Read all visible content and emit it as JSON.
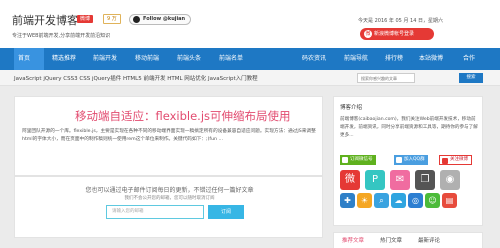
{
  "header": {
    "site_title": "前端开发博客",
    "hot_tag": "微博",
    "count_tag": "9 万",
    "follow_label": "Follow @kujian",
    "slogan": "专注于WEB前端开发,分享前端开发前沿知识",
    "date": "今天是 2016 年 05 月 14 日，星期六",
    "weibo_login": "新浪微博帐号登录"
  },
  "nav": {
    "items": [
      "首页",
      "精选推荐",
      "前端开发",
      "移动前端",
      "前端头条",
      "前端名单",
      "码农资讯",
      "前端导航",
      "排行榜",
      "本站微博",
      "合作"
    ]
  },
  "subnav": {
    "tags": "JavaScript  jQuery  CSS3  CSS  jQuery插件  HTML5  前端开发  HTML  网站优化  JavaScript入门教程",
    "search_placeholder": "搜索你感兴趣的文章",
    "search_button": "搜索"
  },
  "article": {
    "title": "移动端自适应：flexible.js可伸缩布局使用",
    "excerpt": "阿里团队开源的一个库。flexible.js，主要是实现在各种不同的移动端界面实现一稿搞定所有的设备兼容自适应问题。实现方法：通过JS来调整html的字体大小，而在页面中的制作稿则统一使用rem这个单位来制作。关键代码如下：;(fun ..."
  },
  "subscribe": {
    "title": "您也可以通过电子邮件订阅每日的更新，不错过任何一篇好文章",
    "note": "我们不会公开您的邮箱，您可以随时取消订阅",
    "email_placeholder": "请输入您的邮箱",
    "button": "订阅"
  },
  "about": {
    "title": "博客介绍",
    "text": "前端博客(caibaojian.com)，我们关注Web前端开发技术，移动前端开发，前端资讯，同时分享前端资源和工具等，期待你的参与了解更多...",
    "follow_wechat": "订阅微信号",
    "follow_qq": "加入QQ群",
    "follow_weibo": "关注微博"
  },
  "social_icons": [
    {
      "icon": "weibo-icon",
      "glyph": "微",
      "color": "#e53935"
    },
    {
      "icon": "pinterest-icon",
      "glyph": "P",
      "color": "#34c6c2"
    },
    {
      "icon": "mail-icon",
      "glyph": "✉",
      "color": "#f06ca0"
    },
    {
      "icon": "bookmark-icon",
      "glyph": "❐",
      "color": "#545454"
    },
    {
      "icon": "rss-icon",
      "glyph": "◉",
      "color": "#b0b0b0"
    },
    {
      "icon": "grid-icon",
      "glyph": "✚",
      "color": "#2f80c8"
    },
    {
      "icon": "sun-icon",
      "glyph": "☀",
      "color": "#f5a623"
    },
    {
      "icon": "search-icon",
      "glyph": "⌕",
      "color": "#3aa3e0"
    },
    {
      "icon": "chat-icon",
      "glyph": "☁",
      "color": "#2fa5e0"
    },
    {
      "icon": "qq-icon",
      "glyph": "◎",
      "color": "#2d7fd2"
    },
    {
      "icon": "wechat-icon",
      "glyph": "☺",
      "color": "#4cbb3a"
    },
    {
      "icon": "doc-icon",
      "glyph": "▤",
      "color": "#e74b3c"
    }
  ],
  "sidebar_tabs": [
    "推荐文章",
    "热门文章",
    "最新评论"
  ]
}
